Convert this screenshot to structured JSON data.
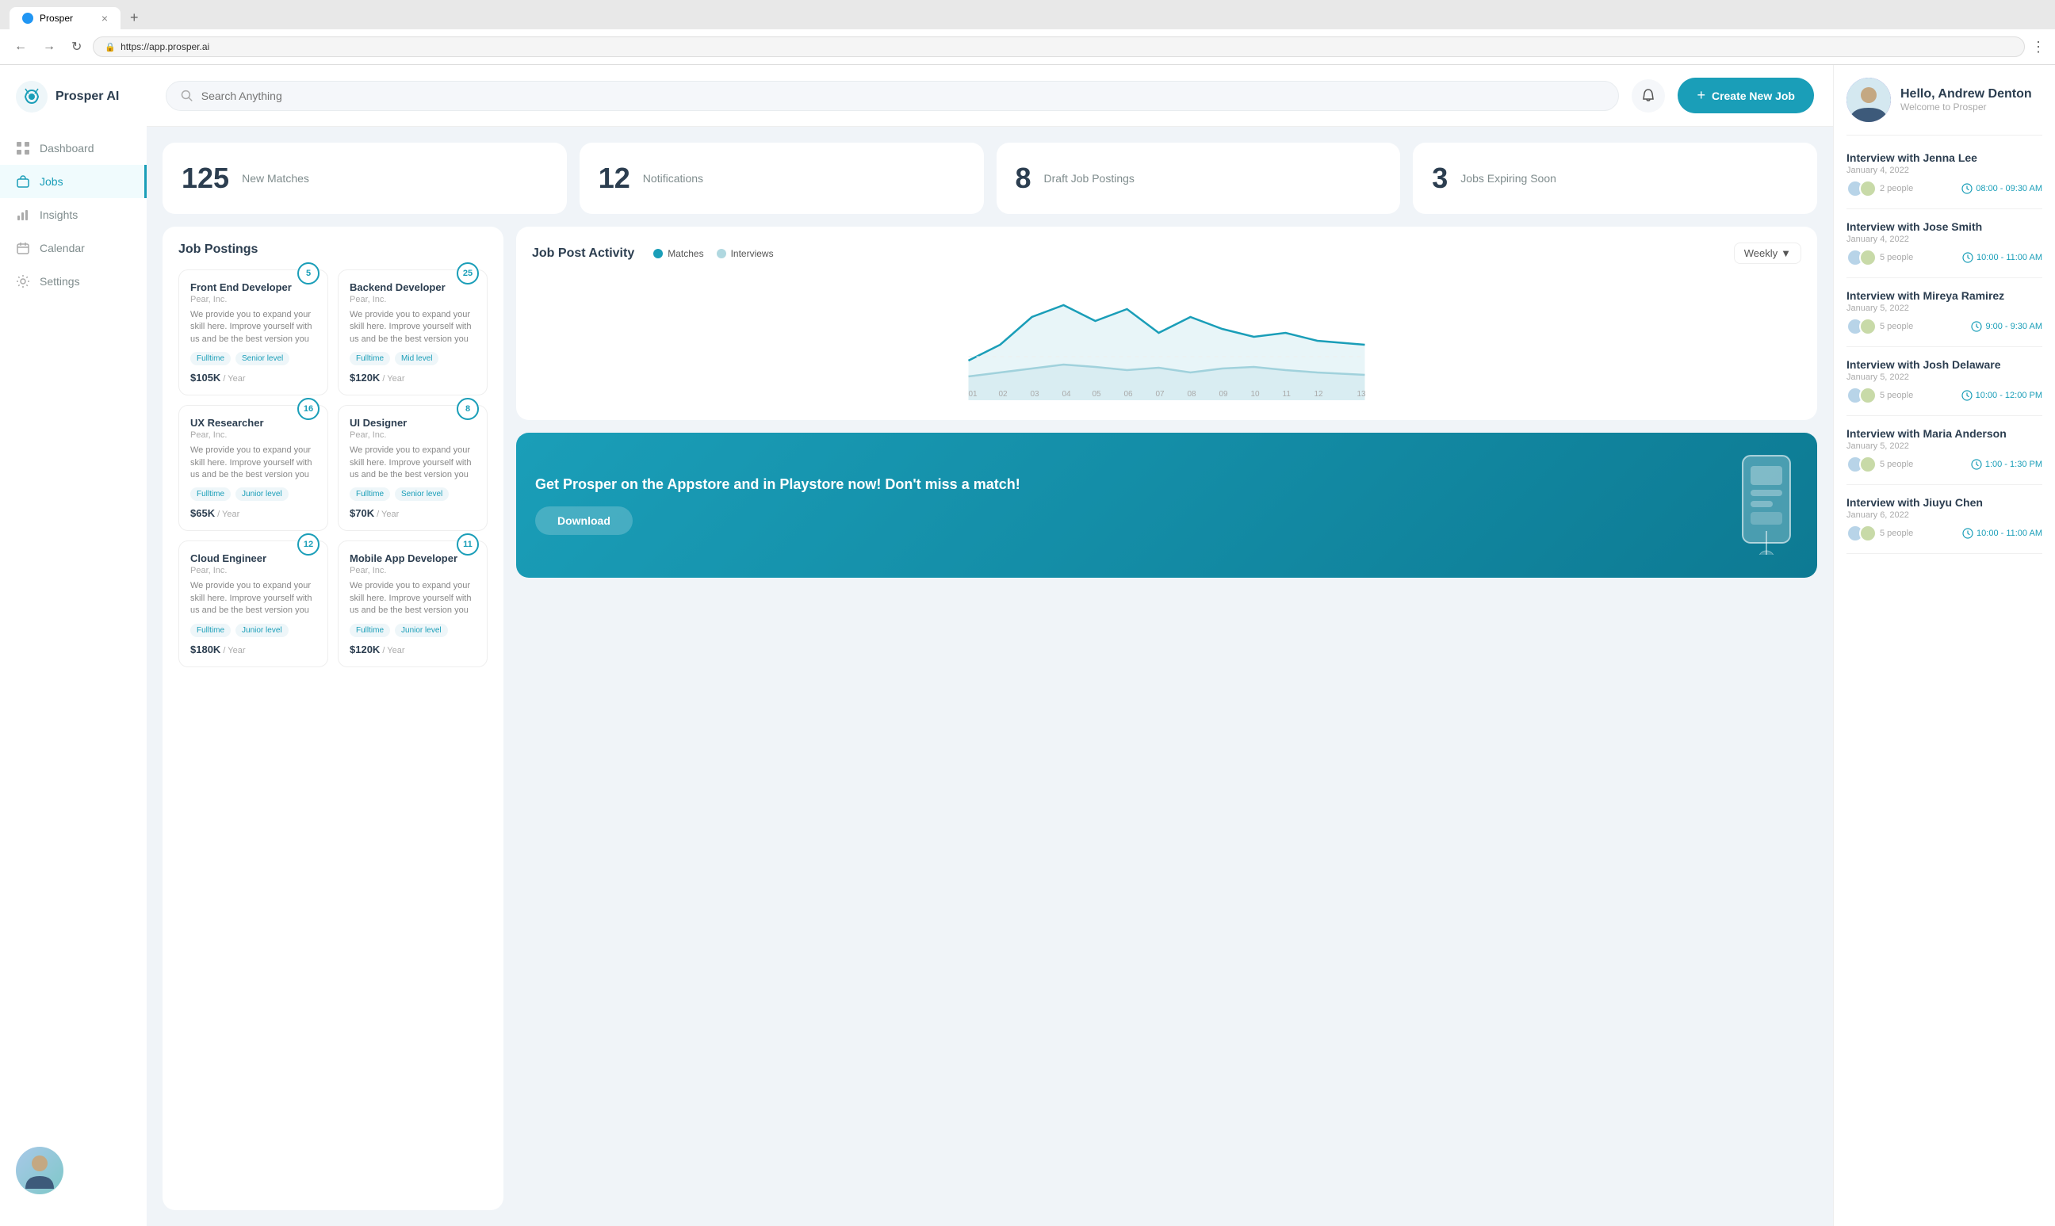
{
  "browser": {
    "tab_title": "Prosper",
    "url": "https://app.prosper.ai",
    "new_tab_label": "+"
  },
  "sidebar": {
    "logo_text": "Prosper AI",
    "nav_items": [
      {
        "id": "dashboard",
        "label": "Dashboard",
        "icon": "grid"
      },
      {
        "id": "jobs",
        "label": "Jobs",
        "icon": "briefcase",
        "active": true
      },
      {
        "id": "insights",
        "label": "Insights",
        "icon": "bar-chart"
      },
      {
        "id": "calendar",
        "label": "Calendar",
        "icon": "calendar"
      },
      {
        "id": "settings",
        "label": "Settings",
        "icon": "settings"
      }
    ]
  },
  "header": {
    "search_placeholder": "Search Anything",
    "create_job_label": "Create New Job"
  },
  "stats": [
    {
      "number": "125",
      "label": "New Matches"
    },
    {
      "number": "12",
      "label": "Notifications"
    },
    {
      "number": "8",
      "label": "Draft Job Postings"
    },
    {
      "number": "3",
      "label": "Jobs Expiring Soon"
    }
  ],
  "job_postings": {
    "title": "Job Postings",
    "jobs": [
      {
        "title": "Front End Developer",
        "company": "Pear, Inc.",
        "description": "We provide you to expand your skill here. Improve yourself with us and be the best version you",
        "tags": [
          "Fulltime",
          "Senior level"
        ],
        "salary": "$105K",
        "period": "/ Year",
        "badge": "5"
      },
      {
        "title": "Backend Developer",
        "company": "Pear, Inc.",
        "description": "We provide you to expand your skill here. Improve yourself with us and be the best version you",
        "tags": [
          "Fulltime",
          "Mid level"
        ],
        "salary": "$120K",
        "period": "/ Year",
        "badge": "25"
      },
      {
        "title": "UX Researcher",
        "company": "Pear, Inc.",
        "description": "We provide you to expand your skill here. Improve yourself with us and be the best version you",
        "tags": [
          "Fulltime",
          "Junior level"
        ],
        "salary": "$65K",
        "period": "/ Year",
        "badge": "16"
      },
      {
        "title": "UI Designer",
        "company": "Pear, Inc.",
        "description": "We provide you to expand your skill here. Improve yourself with us and be the best version you",
        "tags": [
          "Fulltime",
          "Senior level"
        ],
        "salary": "$70K",
        "period": "/ Year",
        "badge": "8"
      },
      {
        "title": "Cloud Engineer",
        "company": "Pear, Inc.",
        "description": "We provide you to expand your skill here. Improve yourself with us and be the best version you",
        "tags": [
          "Fulltime",
          "Junior level"
        ],
        "salary": "$180K",
        "period": "/ Year",
        "badge": "12"
      },
      {
        "title": "Mobile App Developer",
        "company": "Pear, Inc.",
        "description": "We provide you to expand your skill here. Improve yourself with us and be the best version you",
        "tags": [
          "Fulltime",
          "Junior level"
        ],
        "salary": "$120K",
        "period": "/ Year",
        "badge": "11"
      }
    ]
  },
  "chart": {
    "title": "Job Post Activity",
    "legend": [
      {
        "label": "Matches",
        "color": "#1a9eb8"
      },
      {
        "label": "Interviews",
        "color": "#b0d8e0"
      }
    ],
    "filter": "Weekly",
    "x_labels": [
      "01",
      "02",
      "03",
      "04",
      "05",
      "06",
      "07",
      "08",
      "09",
      "10",
      "11",
      "12",
      "13"
    ]
  },
  "promo": {
    "title": "Get Prosper on the Appstore and in Playstore now! Don't miss a match!",
    "button_label": "Download"
  },
  "right_sidebar": {
    "greeting": "Hello, Andrew Denton",
    "sub": "Welcome to Prosper",
    "interviews": [
      {
        "name": "Interview with Jenna Lee",
        "date": "January 4, 2022",
        "people": "2 people",
        "time": "08:00 - 09:30 AM"
      },
      {
        "name": "Interview with Jose Smith",
        "date": "January 4, 2022",
        "people": "5 people",
        "time": "10:00 - 11:00 AM"
      },
      {
        "name": "Interview with Mireya Ramirez",
        "date": "January 5, 2022",
        "people": "5 people",
        "time": "9:00 - 9:30 AM"
      },
      {
        "name": "Interview with Josh Delaware",
        "date": "January 5, 2022",
        "people": "5 people",
        "time": "10:00 - 12:00 PM"
      },
      {
        "name": "Interview with Maria Anderson",
        "date": "January 5, 2022",
        "people": "5 people",
        "time": "1:00 - 1:30 PM"
      },
      {
        "name": "Interview with Jiuyu Chen",
        "date": "January 6, 2022",
        "people": "5 people",
        "time": "10:00 - 11:00 AM"
      }
    ]
  }
}
